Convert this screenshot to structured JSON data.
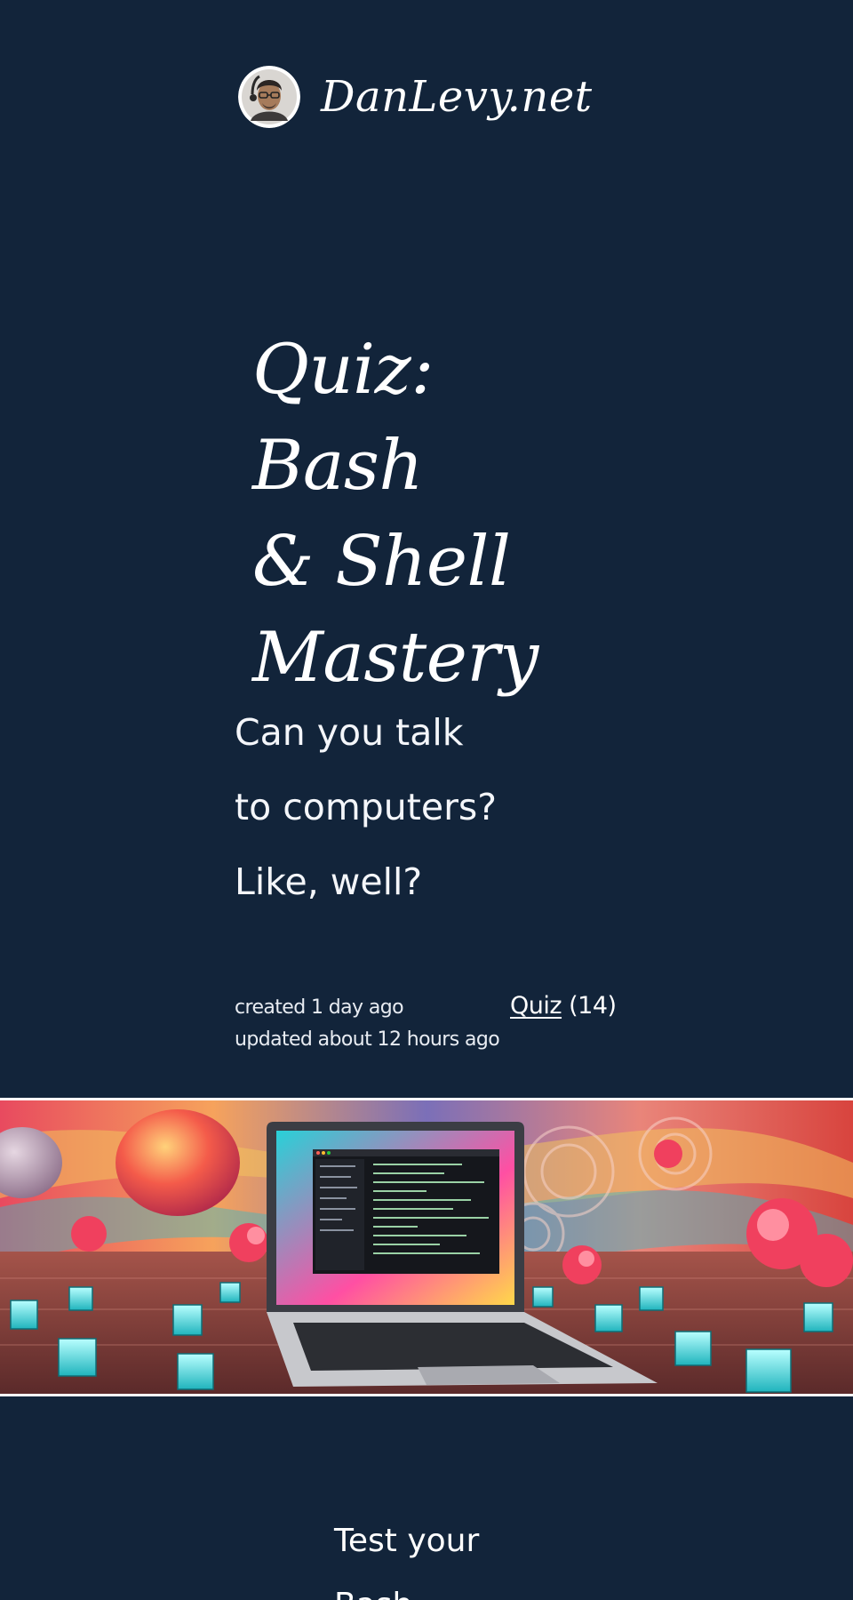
{
  "header": {
    "site_title": "DanLevy.net",
    "avatar_icon": "author-avatar"
  },
  "post": {
    "title_lines": [
      "Quiz: Bash",
      "& Shell",
      "Mastery"
    ],
    "subtitle_lines": [
      "Can you talk",
      "to computers?",
      "Like, well?"
    ],
    "created": "created 1 day ago",
    "updated": "updated about 12 hours ago",
    "tag": {
      "label": "Quiz",
      "count": "(14)"
    },
    "hero_image": "hero-illustration",
    "body_start_lines": [
      "Test your",
      "Bash"
    ]
  },
  "colors": {
    "background": "#12243a",
    "text": "#ffffff"
  }
}
